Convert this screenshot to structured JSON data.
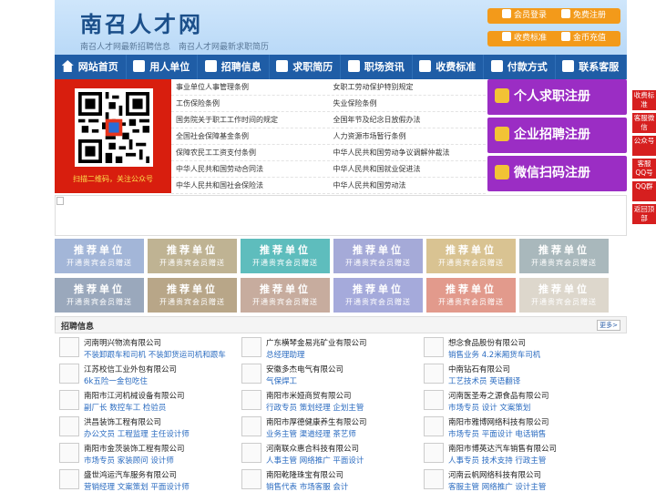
{
  "header": {
    "logo": "南召人才网",
    "slogan": "南召人才网最新招聘信息　南召人才网最新求职简历",
    "buttons": {
      "login": "会员登录",
      "register": "免费注册",
      "pricing": "收费标准",
      "recharge": "金币充值"
    }
  },
  "nav": [
    "网站首页",
    "用人单位",
    "招聘信息",
    "求职简历",
    "职场资讯",
    "收费标准",
    "付款方式",
    "联系客服"
  ],
  "qr": {
    "caption": "扫描二维码，关注公众号"
  },
  "links": [
    [
      "事业单位人事管理条例",
      "女职工劳动保护特别规定"
    ],
    [
      "工伤保险条例",
      "失业保险条例"
    ],
    [
      "国务院关于职工工作时间的规定",
      "全国年节及纪念日放假办法"
    ],
    [
      "全国社会保障基金条例",
      "人力资源市场暂行条例"
    ],
    [
      "保障农民工工资支付条例",
      "中华人民共和国劳动争议调解仲裁法"
    ],
    [
      "中华人民共和国劳动合同法",
      "中华人民共和国就业促进法"
    ],
    [
      "中华人民共和国社会保险法",
      "中华人民共和国劳动法"
    ]
  ],
  "registers": [
    "个人求职注册",
    "企业招聘注册",
    "微信扫码注册"
  ],
  "recommend": {
    "title": "推荐单位",
    "sub": "开通贵宾会员赠送",
    "colors": [
      "#a3b6d8",
      "#bfb393",
      "#5ebdbd",
      "#a5aad8",
      "#d9c392",
      "#a9b8bc",
      "#9aa8bc",
      "#b8a688",
      "#c7ac9e",
      "#a5aadb",
      "#e29a8c",
      "#ddd7cc"
    ]
  },
  "jobs_section": {
    "title": "招聘信息",
    "more": "更多>"
  },
  "jobs": [
    [
      {
        "company": "河南明兴物流有限公司",
        "positions": "不装卸跟车和司机 不装卸货运司机和跟车"
      },
      {
        "company": "江苏校信工业外包有限公司",
        "positions": "6k五险一金包吃住"
      },
      {
        "company": "南阳市江河机械设备有限公司",
        "positions": "副厂长 数控车工 检验员"
      },
      {
        "company": "洪昌装饰工程有限公司",
        "positions": "办公文员 工程监理 主任设计师"
      },
      {
        "company": "南阳市金茨装饰工程有限公司",
        "positions": "市场专员 家装顾问 设计师"
      },
      {
        "company": "盛世鸿运汽车服务有限公司",
        "positions": "营销经理 文案策划 平面设计师"
      }
    ],
    [
      {
        "company": "广东横琴金易兆矿业有限公司",
        "positions": "总经理助理"
      },
      {
        "company": "安徽多杰电气有限公司",
        "positions": "气保焊工"
      },
      {
        "company": "南阳市米娅商贸有限公司",
        "positions": "行政专员 策划经理 企划主管"
      },
      {
        "company": "南阳市厚德健康养生有限公司",
        "positions": "业务主管 渠道经理 茶艺师"
      },
      {
        "company": "河南联众惠合科技有限公司",
        "positions": "人事主管 网络推广 平面设计"
      },
      {
        "company": "南阳乾隆珠宝有限公司",
        "positions": "销售代表 市场客服 会计"
      }
    ],
    [
      {
        "company": "想念食品股份有限公司",
        "positions": "销售业务 4.2米厢货车司机"
      },
      {
        "company": "中南钻石有限公司",
        "positions": "工艺技术员 英语翻译"
      },
      {
        "company": "河南医圣寿之源食品有限公司",
        "positions": "市场专员 设计 文案策划"
      },
      {
        "company": "南阳市雅博网络科技有限公司",
        "positions": "市场专员 平面设计 电话销售"
      },
      {
        "company": "南阳市博英达汽车销售有限公司",
        "positions": "人事专员 技术支持 行政主管"
      },
      {
        "company": "河南云帆网络科技有限公司",
        "positions": "客服主管 网络推广 设计主管"
      }
    ]
  ],
  "side": [
    "收费标准",
    "客服微信",
    "公众号",
    "客服QQ号",
    "QQ群",
    "返回顶部"
  ]
}
